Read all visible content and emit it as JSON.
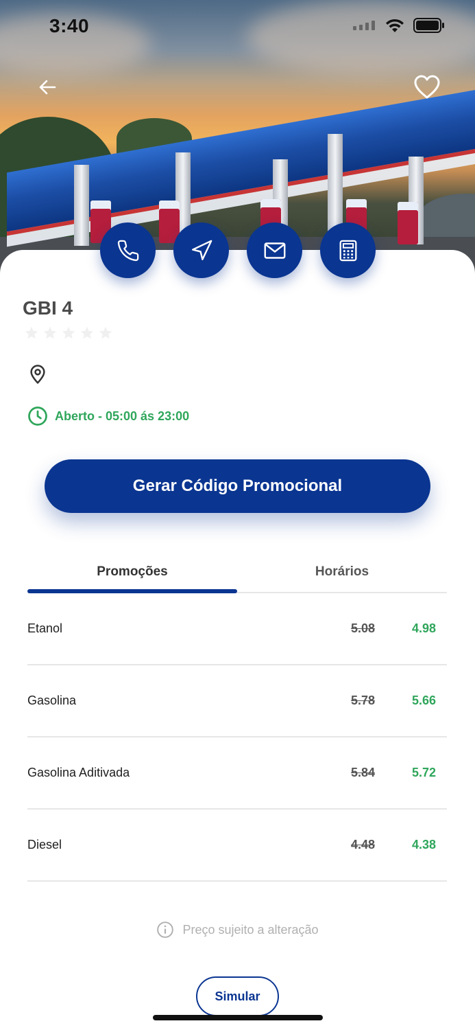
{
  "status_bar": {
    "time": "3:40"
  },
  "hero": {
    "back_icon": "arrow-left-icon",
    "favorite_icon": "heart-icon"
  },
  "actions": [
    {
      "name": "call",
      "icon": "phone-icon"
    },
    {
      "name": "navigate",
      "icon": "navigation-arrow-icon"
    },
    {
      "name": "email",
      "icon": "mail-icon"
    },
    {
      "name": "calculator",
      "icon": "calculator-icon"
    }
  ],
  "station": {
    "name": "GBI 4",
    "rating": 0,
    "rating_max": 5,
    "hours": "Aberto - 05:00 ás 23:00"
  },
  "promo_button": {
    "label": "Gerar Código Promocional"
  },
  "tabs": [
    {
      "label": "Promoções",
      "active": true
    },
    {
      "label": "Horários",
      "active": false
    }
  ],
  "prices": [
    {
      "fuel": "Etanol",
      "old": "5.08",
      "new": "4.98"
    },
    {
      "fuel": "Gasolina",
      "old": "5.78",
      "new": "5.66"
    },
    {
      "fuel": "Gasolina Aditivada",
      "old": "5.84",
      "new": "5.72"
    },
    {
      "fuel": "Diesel",
      "old": "4.48",
      "new": "4.38"
    }
  ],
  "disclaimer": "Preço sujeito a alteração",
  "simulate_button": {
    "label": "Simular"
  },
  "colors": {
    "primary": "#0a3591",
    "success": "#2fa65b",
    "muted": "#b0b0b0"
  }
}
